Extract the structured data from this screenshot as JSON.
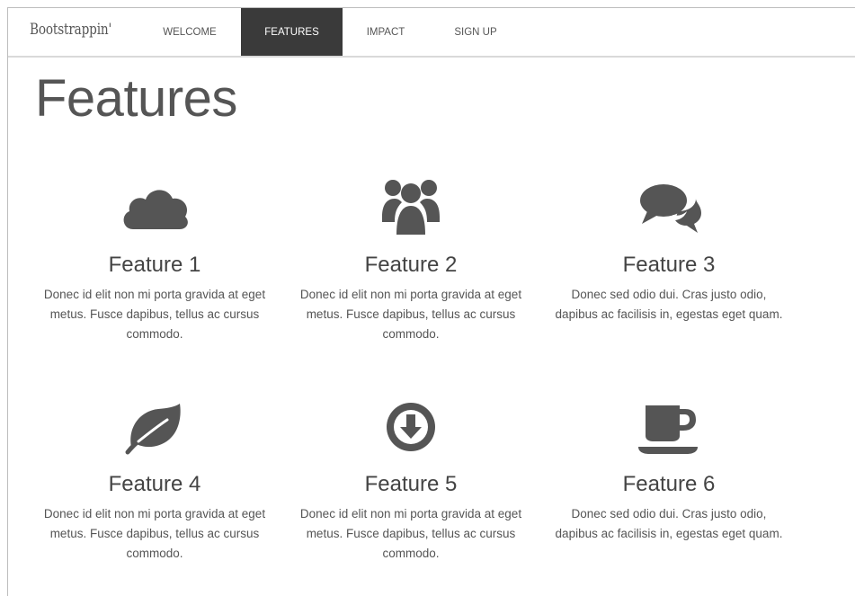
{
  "nav": {
    "brand": "Bootstrappin'",
    "items": [
      {
        "label": "WELCOME",
        "active": false
      },
      {
        "label": "FEATURES",
        "active": true
      },
      {
        "label": "IMPACT",
        "active": false
      },
      {
        "label": "SIGN UP",
        "active": false
      }
    ]
  },
  "page_title": "Features",
  "features": [
    {
      "icon": "cloud-icon",
      "title": "Feature 1",
      "text": "Donec id elit non mi porta gravida at eget metus. Fusce dapibus, tellus ac cursus commodo."
    },
    {
      "icon": "group-icon",
      "title": "Feature 2",
      "text": "Donec id elit non mi porta gravida at eget metus. Fusce dapibus, tellus ac cursus commodo."
    },
    {
      "icon": "comments-icon",
      "title": "Feature 3",
      "text": "Donec sed odio dui. Cras justo odio, dapibus ac facilisis in, egestas eget quam."
    },
    {
      "icon": "leaf-icon",
      "title": "Feature 4",
      "text": "Donec id elit non mi porta gravida at eget metus. Fusce dapibus, tellus ac cursus commodo."
    },
    {
      "icon": "download-circle-icon",
      "title": "Feature 5",
      "text": "Donec id elit non mi porta gravida at eget metus. Fusce dapibus, tellus ac cursus commodo."
    },
    {
      "icon": "coffee-cup-icon",
      "title": "Feature 6",
      "text": "Donec sed odio dui. Cras justo odio, dapibus ac facilisis in, egestas eget quam."
    }
  ],
  "colors": {
    "icon": "#555555",
    "nav_active_bg": "#3a3a3a",
    "nav_active_text": "#ffffff",
    "text": "#444444"
  }
}
